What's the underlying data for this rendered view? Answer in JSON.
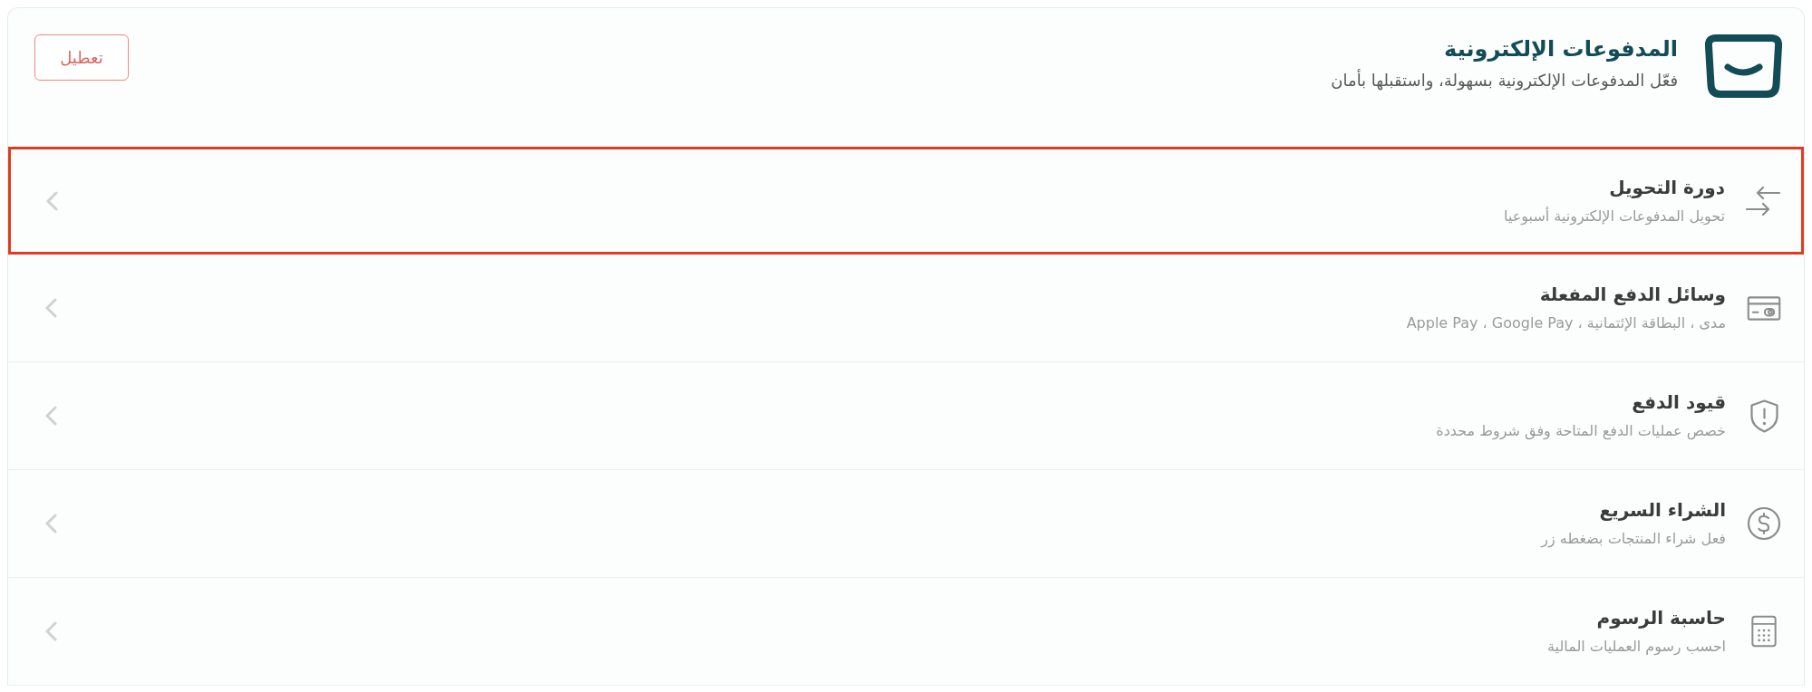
{
  "header": {
    "title": "المدفوعات الإلكترونية",
    "subtitle": "فعّل المدفوعات الإلكترونية بسهولة، واستقبلها بأمان",
    "button": "تعطيل"
  },
  "settings": [
    {
      "kind": "transfer",
      "title": "دورة التحويل",
      "description": "تحويل المدفوعات الإلكترونية أسبوعيا",
      "highlighted": true
    },
    {
      "kind": "card",
      "title": "وسائل الدفع المفعلة",
      "description": "مدى ، البطاقة الإئتمانية ، Apple Pay ، Google Pay",
      "highlighted": false
    },
    {
      "kind": "shield",
      "title": "قيود الدفع",
      "description": "خصص عمليات الدفع المتاحة وفق شروط محددة",
      "highlighted": false
    },
    {
      "kind": "dollar",
      "title": "الشراء السريع",
      "description": "فعل شراء المنتجات بضغطه زر",
      "highlighted": false
    },
    {
      "kind": "calculator",
      "title": "حاسبة الرسوم",
      "description": "احسب رسوم العمليات المالية",
      "highlighted": false
    }
  ]
}
